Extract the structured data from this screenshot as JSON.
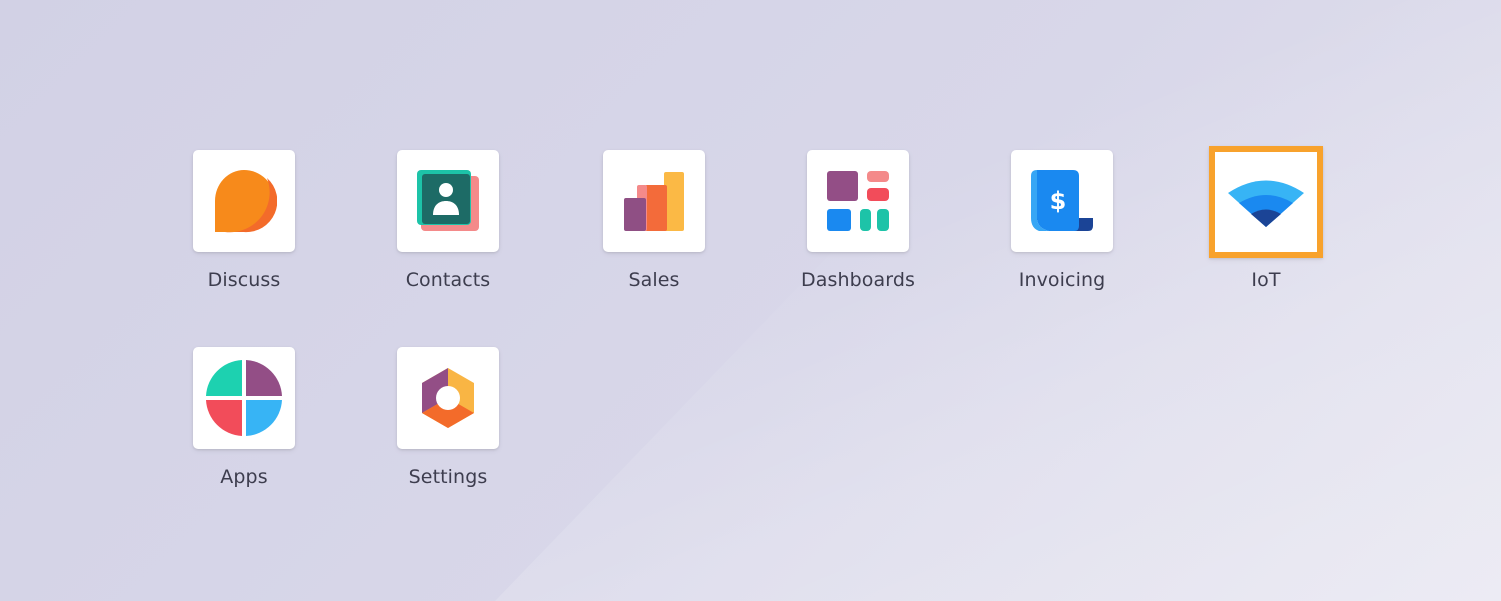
{
  "apps": [
    {
      "label": "Discuss",
      "icon": "discuss-icon"
    },
    {
      "label": "Contacts",
      "icon": "contacts-icon"
    },
    {
      "label": "Sales",
      "icon": "sales-icon"
    },
    {
      "label": "Dashboards",
      "icon": "dashboards-icon"
    },
    {
      "label": "Invoicing",
      "icon": "invoicing-icon"
    },
    {
      "label": "IoT",
      "icon": "iot-icon",
      "highlighted": true
    },
    {
      "label": "Apps",
      "icon": "apps-icon"
    },
    {
      "label": "Settings",
      "icon": "settings-icon"
    }
  ],
  "colors": {
    "background": "#d6d5e7",
    "highlight": "#f8a22c",
    "label": "#3d3d4e"
  }
}
